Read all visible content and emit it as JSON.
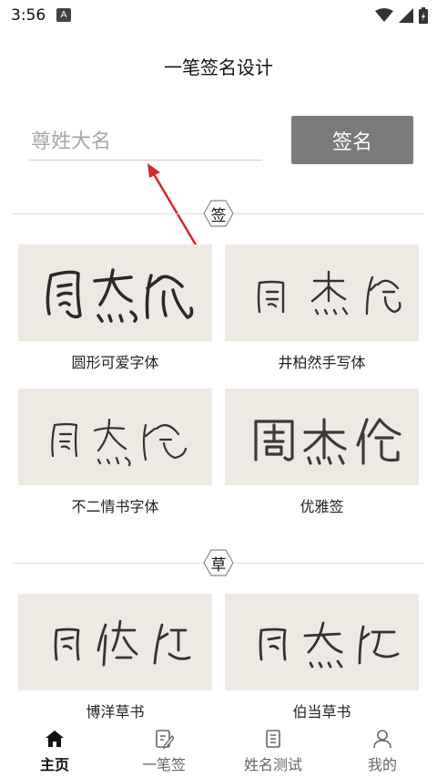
{
  "status_bar": {
    "time": "3:56",
    "notif_glyph": "A"
  },
  "header": {
    "title": "一笔签名设计"
  },
  "search": {
    "placeholder": "尊姓大名",
    "value": ""
  },
  "sign_button": {
    "label": "签名"
  },
  "sections": [
    {
      "badge": "签",
      "cards": [
        {
          "label": "圆形可爱字体",
          "preview": "周杰伦"
        },
        {
          "label": "井柏然手写体",
          "preview": "周杰伦"
        },
        {
          "label": "不二情书字体",
          "preview": "周杰伦"
        },
        {
          "label": "优雅签",
          "preview": "周杰伦"
        }
      ]
    },
    {
      "badge": "草",
      "cards": [
        {
          "label": "博洋草书",
          "preview": "周杰伦"
        },
        {
          "label": "伯当草书",
          "preview": "周杰伦"
        }
      ]
    }
  ],
  "bottom_nav": [
    {
      "label": "主页",
      "icon": "home-icon",
      "active": true
    },
    {
      "label": "一笔签",
      "icon": "pen-edit-icon",
      "active": false
    },
    {
      "label": "姓名测试",
      "icon": "document-icon",
      "active": false
    },
    {
      "label": "我的",
      "icon": "user-icon",
      "active": false
    }
  ],
  "colors": {
    "card_bg": "#eeeae3",
    "button_bg": "#7b7b7b",
    "arrow": "#d9262c",
    "active_nav": "#111111",
    "inactive_nav": "#666666"
  }
}
